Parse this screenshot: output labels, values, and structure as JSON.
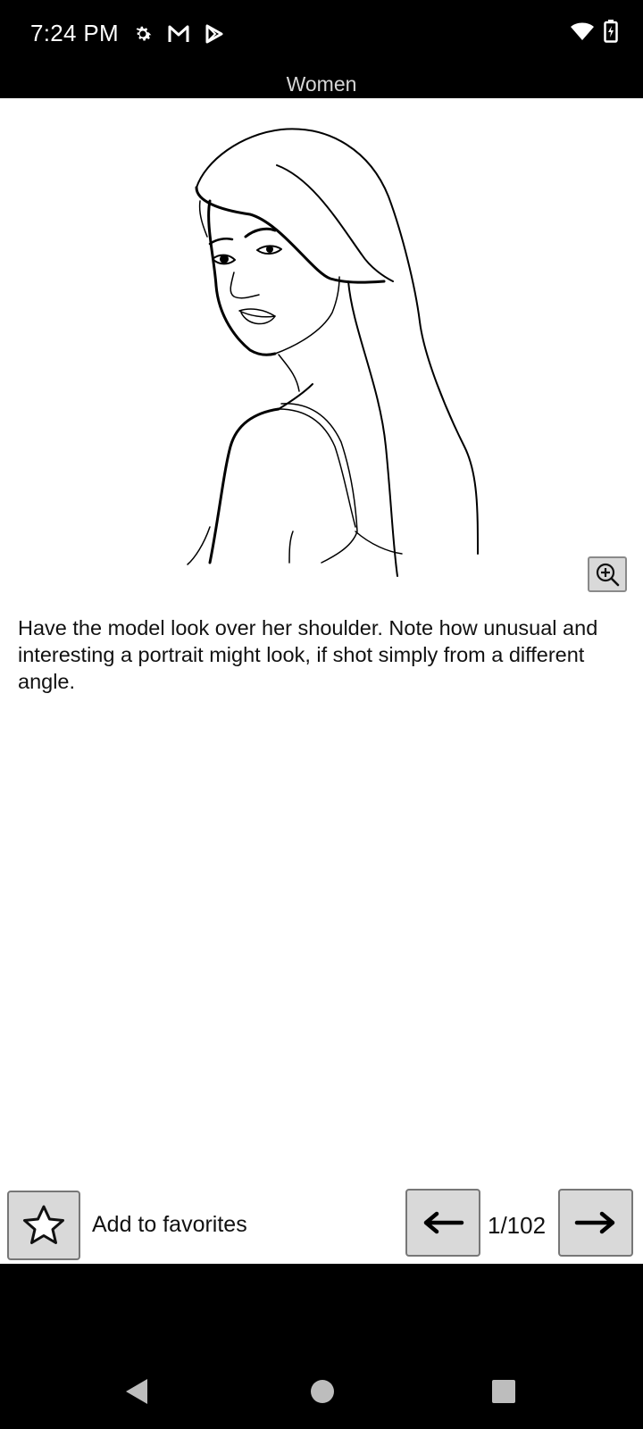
{
  "status_bar": {
    "time": "7:24 PM",
    "icons_left": [
      "settings-icon",
      "gmail-icon",
      "play-store-icon"
    ],
    "icons_right": [
      "wifi-icon",
      "battery-charging-icon"
    ]
  },
  "header": {
    "title": "Women"
  },
  "content": {
    "illustration": "woman-looking-over-shoulder-sketch",
    "description": "Have the model look over her shoulder. Note how unusual and interesting a portrait might look, if shot simply from a different angle."
  },
  "toolbar": {
    "favorites_label": "Add to favorites",
    "page_current": 1,
    "page_total": 102,
    "page_label": "1/102"
  },
  "system_nav": [
    "back",
    "home",
    "recents"
  ]
}
